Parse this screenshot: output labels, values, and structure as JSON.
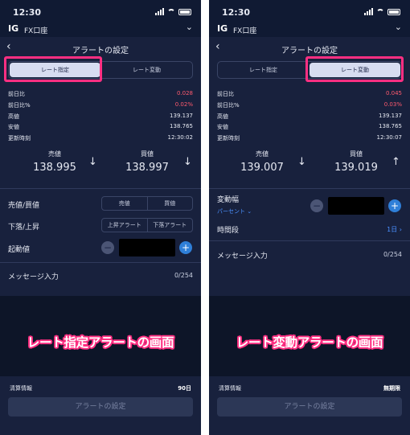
{
  "left": {
    "status_time": "12:30",
    "logo": "IG",
    "account": "FX口座",
    "nav_title": "アラートの設定",
    "tabs": [
      "レート指定",
      "レート変動"
    ],
    "stats": [
      {
        "label": "前日比",
        "value": "0.028",
        "red": true
      },
      {
        "label": "前日比%",
        "value": "0.02%",
        "red": true
      },
      {
        "label": "高値",
        "value": "139.137",
        "red": false
      },
      {
        "label": "安値",
        "value": "138.765",
        "red": false
      },
      {
        "label": "更新時刻",
        "value": "12:30:02",
        "red": false
      }
    ],
    "sell_label": "売値",
    "sell_value": "138.995",
    "sell_arrow": "↓",
    "buy_label": "買値",
    "buy_value": "138.997",
    "buy_arrow": "↓",
    "side_label": "売値/買値",
    "side_options": [
      "売値",
      "買値"
    ],
    "direction_label": "下落/上昇",
    "direction_options": [
      "上昇アラート",
      "下落アラート"
    ],
    "trigger_label": "起動値",
    "message_label": "メッセージ入力",
    "message_count": "0/254",
    "caption": "レート指定アラートの画面",
    "info_label": "清算情報",
    "info_value": "90日",
    "save_label": "アラートの設定"
  },
  "right": {
    "status_time": "12:30",
    "logo": "IG",
    "account": "FX口座",
    "nav_title": "アラートの設定",
    "tabs": [
      "レート指定",
      "レート変動"
    ],
    "stats": [
      {
        "label": "前日比",
        "value": "0.045",
        "red": true
      },
      {
        "label": "前日比%",
        "value": "0.03%",
        "red": true
      },
      {
        "label": "高値",
        "value": "139.137",
        "red": false
      },
      {
        "label": "安値",
        "value": "138.765",
        "red": false
      },
      {
        "label": "更新時刻",
        "value": "12:30:07",
        "red": false
      }
    ],
    "sell_label": "売値",
    "sell_value": "139.007",
    "sell_arrow": "↓",
    "buy_label": "買値",
    "buy_value": "139.019",
    "buy_arrow": "↑",
    "change_label": "変動幅",
    "unit_select": "パーセント ⌄",
    "period_label": "時間段",
    "period_value": "1日 ›",
    "message_label": "メッセージ入力",
    "message_count": "0/254",
    "caption": "レート変動アラートの画面",
    "info_label": "清算情報",
    "info_value": "無期限",
    "save_label": "アラートの設定"
  },
  "colors": {
    "background": "#18213d",
    "highlight": "#ff2f82",
    "negative": "#ff5a6e",
    "link": "#4a90ff"
  }
}
